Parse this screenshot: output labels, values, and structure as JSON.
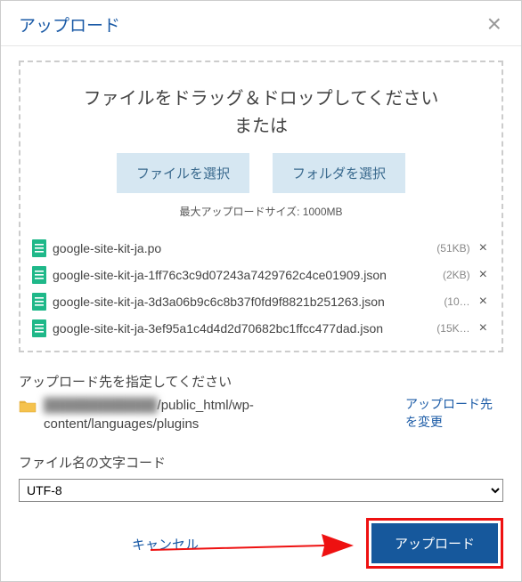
{
  "dialog": {
    "title": "アップロード"
  },
  "dropzone": {
    "message_line1": "ファイルをドラッグ＆ドロップしてください",
    "message_line2": "または",
    "select_file_label": "ファイルを選択",
    "select_folder_label": "フォルダを選択",
    "max_size_label": "最大アップロードサイズ: 1000MB"
  },
  "files": [
    {
      "name": "google-site-kit-ja.po",
      "size": "(51KB)"
    },
    {
      "name": "google-site-kit-ja-1ff76c3c9d07243a7429762c4ce01909.json",
      "size": "(2KB)"
    },
    {
      "name": "google-site-kit-ja-3d3a06b9c6c8b37f0fd9f8821b251263.json",
      "size": "(10…"
    },
    {
      "name": "google-site-kit-ja-3ef95a1c4d4d2d70682bc1ffcc477dad.json",
      "size": "(15K…"
    }
  ],
  "destination": {
    "section_label": "アップロード先を指定してください",
    "path_prefix_blurred": "████████████",
    "path_suffix": "/public_html/wp-content/languages/plugins",
    "change_label": "アップロード先を変更"
  },
  "encoding": {
    "section_label": "ファイル名の文字コード",
    "selected": "UTF-8"
  },
  "footer": {
    "cancel_label": "キャンセル",
    "upload_label": "アップロード"
  }
}
